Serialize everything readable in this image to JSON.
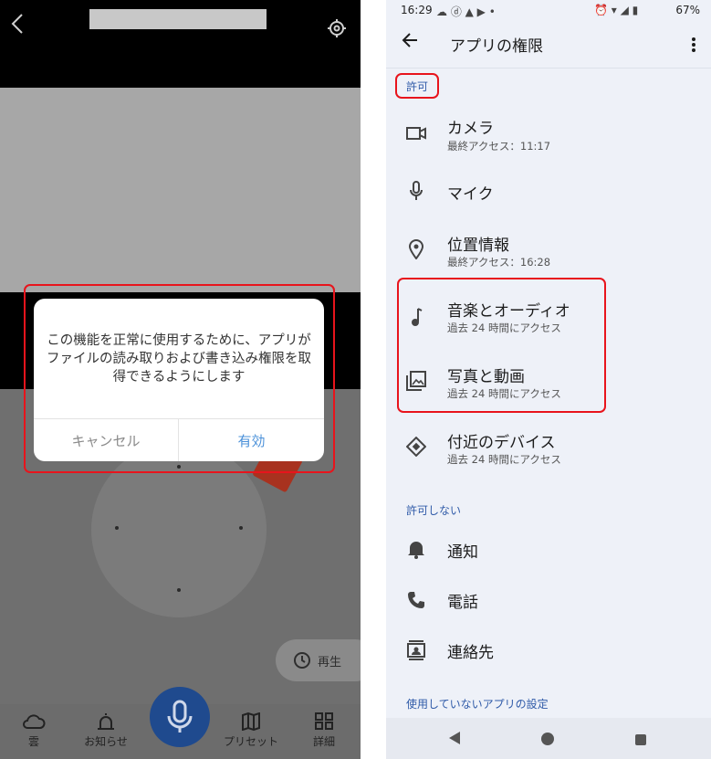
{
  "left": {
    "dialog": {
      "message": "この機能を正常に使用するために、アプリがファイルの読み取りおよび書き込み権限を取得できるようにします",
      "cancel": "キャンセル",
      "ok": "有効"
    },
    "replay_label": "再生",
    "nav": [
      {
        "label": "雲",
        "icon": "cloud-icon"
      },
      {
        "label": "お知らせ",
        "icon": "alarm-light-icon"
      },
      {
        "label": "プリセット",
        "icon": "map-icon"
      },
      {
        "label": "詳細",
        "icon": "grid-icon"
      }
    ],
    "accent_color": "#e8141c"
  },
  "right": {
    "status": {
      "time": "16:29",
      "battery": "67%"
    },
    "title": "アプリの権限",
    "allowed_header": "許可",
    "allowed": [
      {
        "title": "カメラ",
        "sub": "最終アクセス：11:17",
        "icon": "camera-icon"
      },
      {
        "title": "マイク",
        "sub": "",
        "icon": "mic-icon"
      },
      {
        "title": "位置情報",
        "sub": "最終アクセス：16:28",
        "icon": "location-icon"
      },
      {
        "title": "音楽とオーディオ",
        "sub": "過去 24 時間にアクセス",
        "icon": "music-note-icon"
      },
      {
        "title": "写真と動画",
        "sub": "過去 24 時間にアクセス",
        "icon": "photo-icon"
      },
      {
        "title": "付近のデバイス",
        "sub": "過去 24 時間にアクセス",
        "icon": "nearby-icon"
      }
    ],
    "denied_header": "許可しない",
    "denied": [
      {
        "title": "通知",
        "icon": "bell-icon"
      },
      {
        "title": "電話",
        "icon": "phone-icon"
      },
      {
        "title": "連絡先",
        "icon": "contact-icon"
      }
    ],
    "unused_header": "使用していないアプリの設定"
  }
}
